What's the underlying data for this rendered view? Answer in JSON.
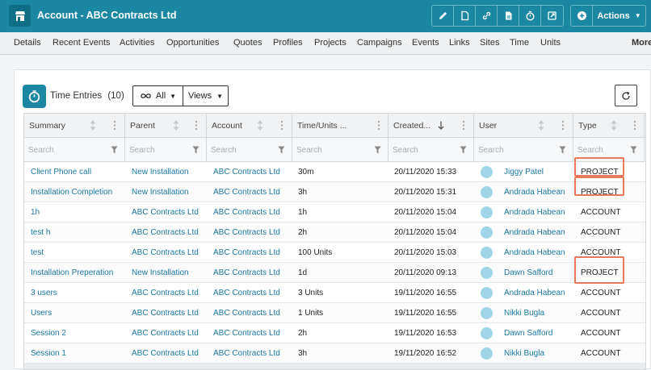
{
  "header": {
    "title": "Account - ABC Contracts Ltd",
    "app_icon": "store-icon",
    "toolbar_icons": [
      "pencil-icon",
      "document-icon",
      "link-icon",
      "file-icon",
      "stopwatch-icon",
      "external-link-icon"
    ],
    "actions_label": "Actions",
    "accent": "#1b87a3"
  },
  "nav": {
    "items": [
      "Details",
      "Recent Events",
      "Activities",
      "Opportunities",
      "Quotes",
      "Profiles",
      "Projects",
      "Campaigns",
      "Events",
      "Links",
      "Sites",
      "Time",
      "Units"
    ],
    "more_label": "More"
  },
  "panel": {
    "title": "Time Entries",
    "count": "(10)",
    "filter_all": "All",
    "views_label": "Views"
  },
  "table": {
    "columns": [
      "Summary",
      "Parent",
      "Account",
      "Time/Units ...",
      "Created...",
      "User",
      "Type"
    ],
    "search_placeholder": "Search",
    "rows": [
      {
        "summary": "Client Phone call",
        "parent": "New Installation",
        "account": "ABC Contracts Ltd",
        "time": "30m",
        "created": "20/11/2020 15:33",
        "user": "Jiggy Patel",
        "type": "PROJECT"
      },
      {
        "summary": "Installation Completion",
        "parent": "New Installation",
        "account": "ABC Contracts Ltd",
        "time": "3h",
        "created": "20/11/2020 15:31",
        "user": "Andrada Habean",
        "type": "PROJECT"
      },
      {
        "summary": "1h",
        "parent": "ABC Contracts Ltd",
        "account": "ABC Contracts Ltd",
        "time": "1h",
        "created": "20/11/2020 15:04",
        "user": "Andrada Habean",
        "type": "ACCOUNT"
      },
      {
        "summary": "test h",
        "parent": "ABC Contracts Ltd",
        "account": "ABC Contracts Ltd",
        "time": "2h",
        "created": "20/11/2020 15:04",
        "user": "Andrada Habean",
        "type": "ACCOUNT"
      },
      {
        "summary": "test",
        "parent": "ABC Contracts Ltd",
        "account": "ABC Contracts Ltd",
        "time": "100 Units",
        "created": "20/11/2020 15:03",
        "user": "Andrada Habean",
        "type": "ACCOUNT"
      },
      {
        "summary": "Installation Preperation",
        "parent": "New Installation",
        "account": "ABC Contracts Ltd",
        "time": "1d",
        "created": "20/11/2020 09:13",
        "user": "Dawn Safford",
        "type": "PROJECT"
      },
      {
        "summary": "3 users",
        "parent": "ABC Contracts Ltd",
        "account": "ABC Contracts Ltd",
        "time": "3 Units",
        "created": "19/11/2020 16:55",
        "user": "Andrada Habean",
        "type": "ACCOUNT"
      },
      {
        "summary": "Users",
        "parent": "ABC Contracts Ltd",
        "account": "ABC Contracts Ltd",
        "time": "1 Units",
        "created": "19/11/2020 16:55",
        "user": "Nikki Bugla",
        "type": "ACCOUNT"
      },
      {
        "summary": "Session 2",
        "parent": "ABC Contracts Ltd",
        "account": "ABC Contracts Ltd",
        "time": "2h",
        "created": "19/11/2020 16:53",
        "user": "Dawn Safford",
        "type": "ACCOUNT"
      },
      {
        "summary": "Session 1",
        "parent": "ABC Contracts Ltd",
        "account": "ABC Contracts Ltd",
        "time": "3h",
        "created": "19/11/2020 16:52",
        "user": "Nikki Bugla",
        "type": "ACCOUNT"
      }
    ]
  },
  "highlight_color": "#e8785a"
}
